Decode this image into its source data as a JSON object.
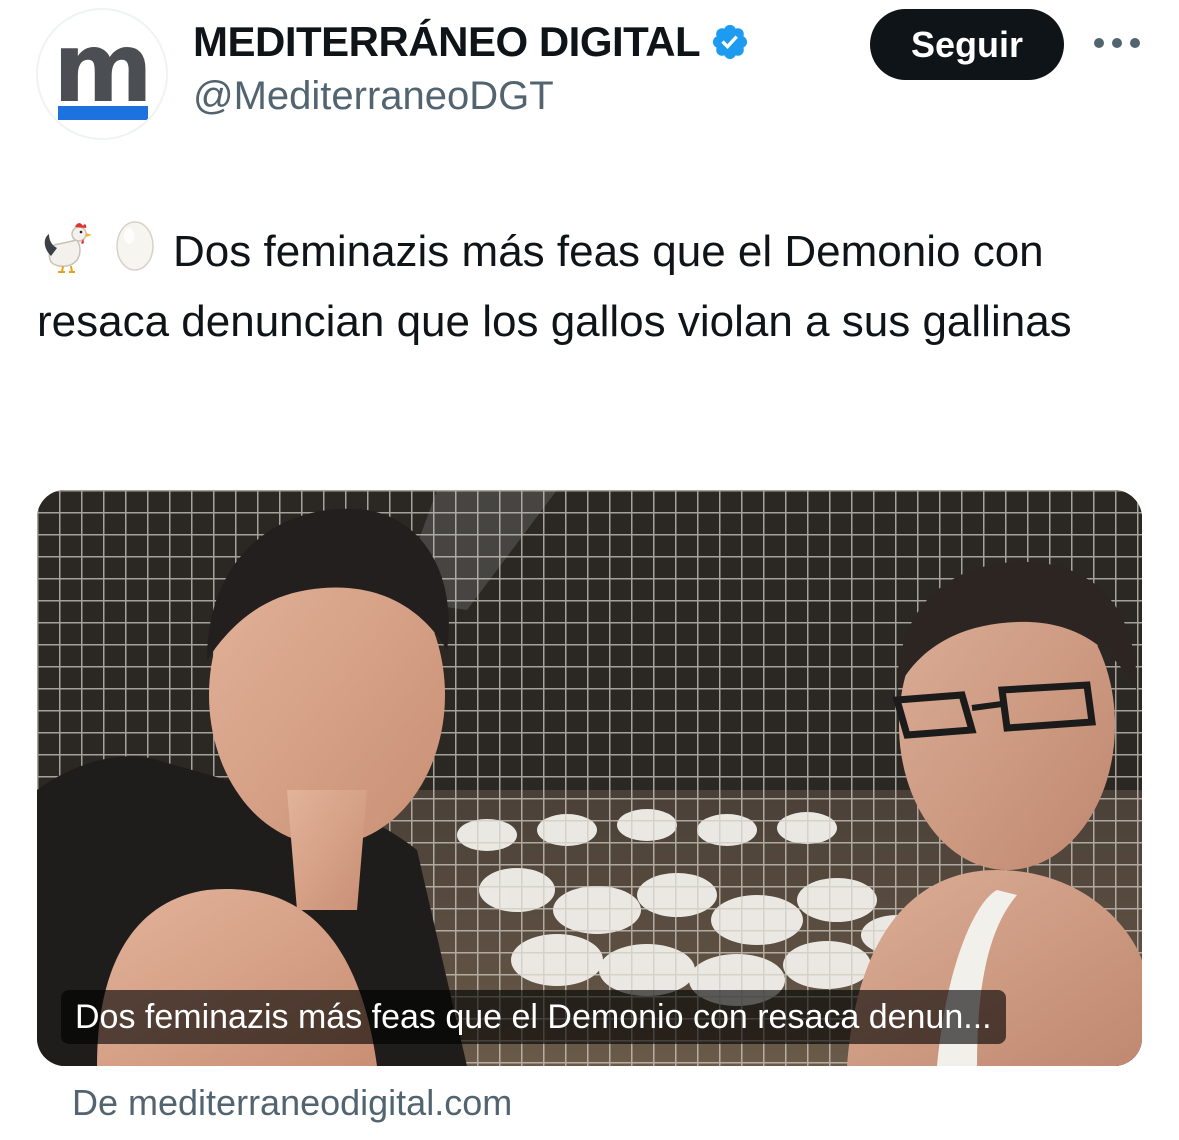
{
  "author": {
    "avatar_letter": "m",
    "display_name": "MEDITERRÁNEO DIGITAL",
    "handle": "@MediterraneoDGT",
    "verified": true
  },
  "follow_label": "Seguir",
  "tweet": {
    "emojis": [
      "rooster",
      "egg"
    ],
    "text": "Dos feminazis más feas que el Demonio con resaca denuncian que los  gallos violan a sus gallinas"
  },
  "card": {
    "caption": "Dos feminazis más feas que el Demonio con resaca denun...",
    "source": "De mediterraneodigital.com"
  },
  "colors": {
    "accent": "#1d9bf0",
    "follow_bg": "#0f1419",
    "secondary_text": "#536471",
    "avatar_bar": "#1d72e0"
  },
  "icons": {
    "verified": "verified-badge-icon",
    "more": "more-options-icon"
  }
}
